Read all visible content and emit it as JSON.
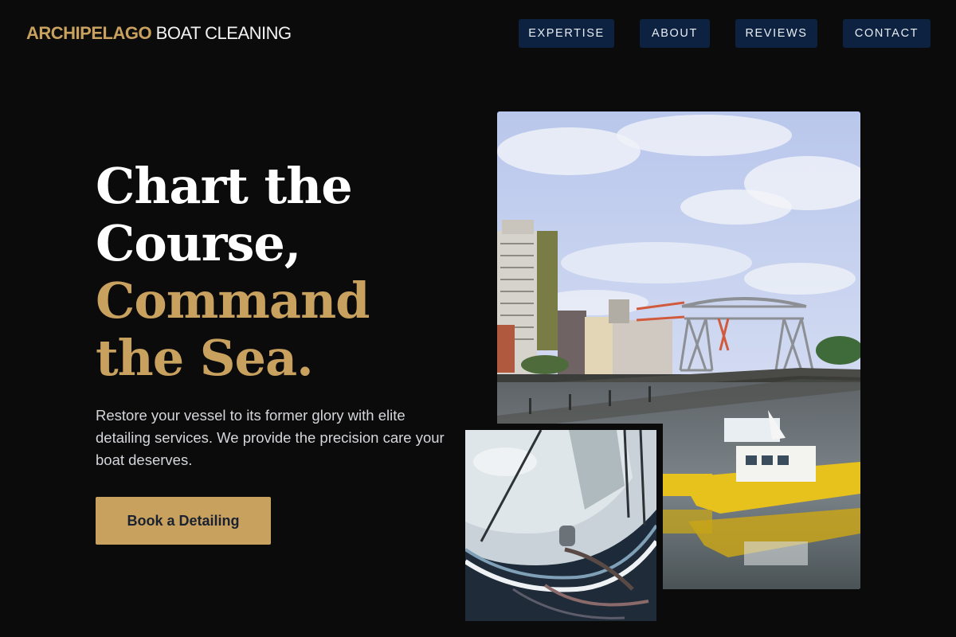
{
  "brand": {
    "accent": "ARCHIPELAGO",
    "rest": " BOAT CLEANING"
  },
  "nav": {
    "items": [
      "EXPERTISE",
      "ABOUT",
      "REVIEWS",
      "CONTACT"
    ]
  },
  "hero": {
    "line1": "Chart the",
    "line2": "Course,",
    "line3": "Command",
    "line4": "the Sea.",
    "description": "Restore your vessel to its former glory with elite detailing services. We provide the precision care your boat deserves.",
    "cta_label": "Book a Detailing"
  },
  "colors": {
    "background": "#0b0b0c",
    "accent_gold": "#c9a15f",
    "nav_bg": "#0d2240"
  },
  "images": {
    "main": "harbor-photo",
    "inset": "boat-bow-photo"
  }
}
